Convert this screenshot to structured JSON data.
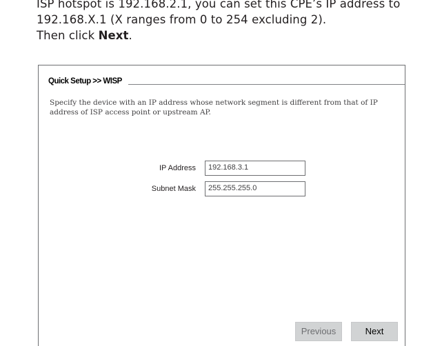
{
  "intro": {
    "line1": "ISP hotspot is 192.168.2.1, you can set this CPE’s IP address to",
    "line2": "192.168.X.1 (X ranges from 0 to 254 excluding 2).",
    "line3_prefix": "Then click ",
    "line3_bold": "Next",
    "line3_suffix": "."
  },
  "panel": {
    "title": "Quick Setup >> WISP",
    "description": "Specify the device with an IP address whose network segment is different from that of IP address of ISP access point or upstream AP."
  },
  "form": {
    "ip_label": "IP Address",
    "ip_value": "192.168.3.1",
    "mask_label": "Subnet Mask",
    "mask_value": "255.255.255.0"
  },
  "buttons": {
    "previous_label": "Previous",
    "next_label": "Next"
  },
  "colors": {
    "button_bg": "#d1d3d4",
    "border": "#6d6e71",
    "text": "#231f20"
  }
}
